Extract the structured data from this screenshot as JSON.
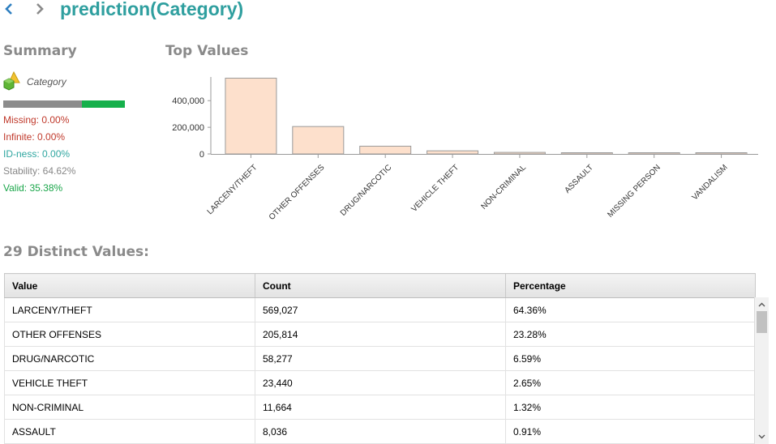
{
  "header": {
    "title": "prediction(Category)"
  },
  "summary": {
    "heading": "Summary",
    "attribute_name": "Category",
    "quality_bar": {
      "gray_fraction": 0.6462,
      "green_fraction": 0.3538,
      "gray_color": "#8c8c8c",
      "green_color": "#16b04b"
    },
    "missing": "Missing: 0.00%",
    "infinite": "Infinite: 0.00%",
    "idness": "ID-ness: 0.00%",
    "stability": "Stability: 64.62%",
    "valid": "Valid: 35.38%",
    "colors": {
      "missing": "#c0392b",
      "infinite": "#c0392b",
      "idness": "#2fa6a0",
      "stability": "#888888",
      "valid": "#1aa64a"
    }
  },
  "top_values": {
    "heading": "Top Values",
    "chart_data": {
      "type": "bar",
      "categories": [
        "LARCENY/THEFT",
        "OTHER OFFENSES",
        "DRUG/NARCOTIC",
        "VEHICLE THEFT",
        "NON-CRIMINAL",
        "ASSAULT",
        "MISSING PERSON",
        "VANDALISM"
      ],
      "values": [
        569027,
        205814,
        58277,
        23440,
        11664,
        8036,
        5900,
        4300
      ],
      "y_ticks": [
        0,
        200000,
        400000
      ],
      "y_tick_labels": [
        "0",
        "200,000",
        "400,000"
      ],
      "ylim": [
        0,
        590000
      ],
      "bar_fill": "#fde0cc",
      "bar_stroke": "#9a9a9a",
      "grid": false
    }
  },
  "distinct": {
    "heading": "29 Distinct Values:",
    "columns": [
      "Value",
      "Count",
      "Percentage"
    ],
    "rows": [
      [
        "LARCENY/THEFT",
        "569,027",
        "64.36%"
      ],
      [
        "OTHER OFFENSES",
        "205,814",
        "23.28%"
      ],
      [
        "DRUG/NARCOTIC",
        "58,277",
        "6.59%"
      ],
      [
        "VEHICLE THEFT",
        "23,440",
        "2.65%"
      ],
      [
        "NON-CRIMINAL",
        "11,664",
        "1.32%"
      ],
      [
        "ASSAULT",
        "8,036",
        "0.91%"
      ]
    ]
  }
}
